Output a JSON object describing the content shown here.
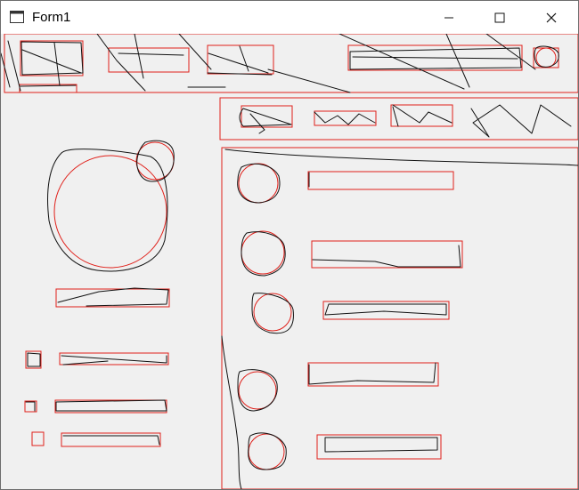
{
  "window": {
    "title": "Form1"
  },
  "titlebar_buttons": {
    "minimize_icon": "minimize-icon",
    "maximize_icon": "maximize-icon",
    "close_icon": "close-icon"
  },
  "colors": {
    "outline": "#e0201a",
    "sketch": "#111111",
    "background": "#f0f0f0",
    "titlebar": "#ffffff"
  }
}
